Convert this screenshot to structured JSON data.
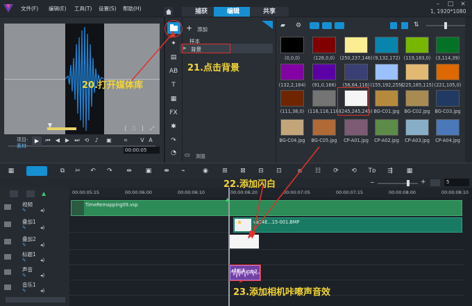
{
  "menu": [
    "文件(F)",
    "编辑(E)",
    "工具(T)",
    "设置(S)",
    "帮助(H)"
  ],
  "workspace_tabs": [
    {
      "label": "捕获",
      "active": false
    },
    {
      "label": "编辑",
      "active": true
    },
    {
      "label": "共享",
      "active": false
    }
  ],
  "resolution": "1, 1920*1080",
  "player": {
    "labels": [
      "项目-",
      "素材-"
    ],
    "timecode": "00:00:05",
    "timecode_right": "5"
  },
  "library": {
    "add_label": "添加",
    "folders": [
      "样本",
      "背景"
    ],
    "browse_label": "浏览",
    "thumbnails": [
      {
        "label": "(0,0,0)",
        "color": "#000000"
      },
      {
        "label": "(128,0,0)",
        "color": "#800000"
      },
      {
        "label": "(250,237,146)",
        "color": "#faed92"
      },
      {
        "label": "(9,132,172)",
        "color": "#0984ac"
      },
      {
        "label": "(119,183,0)",
        "color": "#77b700"
      },
      {
        "label": "(3,114,39)",
        "color": "#037227"
      },
      {
        "label": "(132,2,164)",
        "color": "#8402a4"
      },
      {
        "label": "(91,0,166)",
        "color": "#5b00a6"
      },
      {
        "label": "(58,64,116)",
        "color": "#3a4074"
      },
      {
        "label": "(155,192,255)",
        "color": "#9bc0ff"
      },
      {
        "label": "(225,185,115)",
        "color": "#e1b973"
      },
      {
        "label": "(221,105,0)",
        "color": "#dd6900"
      },
      {
        "label": "(111,38,0)",
        "color": "#6f2600"
      },
      {
        "label": "(116,116,116)",
        "color": "#747474"
      },
      {
        "label": "(245,245,245)",
        "color": "#f5f5f5"
      },
      {
        "label": "BG-C01.jpg",
        "color": "#b58a3e"
      },
      {
        "label": "BG-C02.jpg",
        "color": "#a88b52"
      },
      {
        "label": "BG-C03.jpg",
        "color": "#203a63"
      },
      {
        "label": "BG-C04.jpg",
        "color": "#c2a67a"
      },
      {
        "label": "BG-C05.jpg",
        "color": "#b06a36"
      },
      {
        "label": "CP-A01.jpg",
        "color": "#7d5a73"
      },
      {
        "label": "CP-A02.jpg",
        "color": "#5d8b4a"
      },
      {
        "label": "CP-A03.jpg",
        "color": "#88aec7"
      },
      {
        "label": "CP-A04.jpg",
        "color": "#4a78b8"
      }
    ]
  },
  "ruler_ticks": [
    "00:00:05:15",
    "00:00:06:00",
    "00:00:06:10",
    "00:00:06:20",
    "00:00:07:05",
    "00:00:07:15",
    "00:00:08:00",
    "00:00:08:10"
  ],
  "tracks": [
    {
      "label": "视频"
    },
    {
      "label": "叠加1"
    },
    {
      "label": "叠加2"
    },
    {
      "label": "标题1"
    },
    {
      "label": "声音"
    },
    {
      "label": "音乐1"
    }
  ],
  "clips": {
    "video": "TimeRemapping09.vsp",
    "overlay": "va24E...15-001.BMP",
    "sound": "咔嚓声.mp3"
  },
  "annotations": {
    "step20": "20.打开媒体库",
    "step21": "21.点击背景",
    "step22": "22.添加闪白",
    "step23": "23.添加相机咔嚓声音效"
  }
}
